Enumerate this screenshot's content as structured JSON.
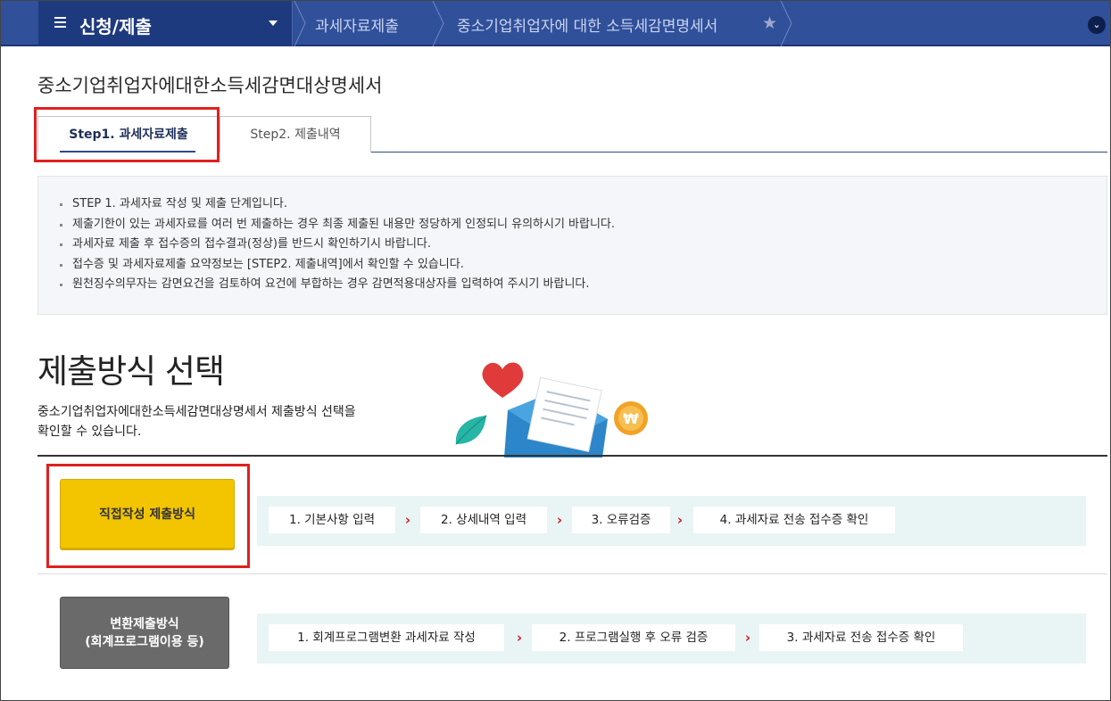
{
  "nav": {
    "menu_label": "신청/제출",
    "breadcrumb_1": "과세자료제출",
    "breadcrumb_2": "중소기업취업자에 대한 소득세감면명세서"
  },
  "page_title": "중소기업취업자에대한소득세감면대상명세서",
  "tabs": {
    "step1": "Step1. 과세자료제출",
    "step2": "Step2. 제출내역"
  },
  "info_items": [
    "STEP 1. 과세자료 작성 및 제출 단계입니다.",
    "제출기한이 있는 과세자료를 여러 번 제출하는 경우 최종 제출된 내용만 정당하게 인정되니 유의하시기 바랍니다.",
    "과세자료 제출 후 접수증의 접수결과(정상)를 반드시 확인하기시 바랍니다.",
    "접수증 및 과세자료제출 요약정보는 [STEP2. 제출내역]에서 확인할 수 있습니다.",
    "원천징수의무자는 감면요건을 검토하여 요건에 부합하는 경우 감면적용대상자를 입력하여 주시기 바랍니다."
  ],
  "section": {
    "heading": "제출방식 선택",
    "desc_line1": "중소기업취업자에대한소득세감면대상명세서 제출방식 선택을",
    "desc_line2": "확인할 수 있습니다."
  },
  "methods": {
    "direct": {
      "label": "직접작성 제출방식",
      "steps": [
        "1. 기본사항 입력",
        "2. 상세내역 입력",
        "3. 오류검증",
        "4. 과세자료 전송 접수증 확인"
      ]
    },
    "convert": {
      "label_line1": "변환제출방식",
      "label_line2": "(회계프로그램이용 등)",
      "steps": [
        "1. 회계프로그램변환 과세자료 작성",
        "2. 프로그램실행 후 오류 검증",
        "3. 과세자료 전송 접수증 확인"
      ]
    }
  },
  "colors": {
    "nav_bg": "#31509a",
    "accent_red": "#e02020",
    "direct_btn": "#f2c500",
    "convert_btn": "#6a6a6a",
    "steps_bg": "#e9f4f4"
  },
  "icons": {
    "menu": "hamburger-icon",
    "dropdown": "chevron-down-icon",
    "favorite": "star-icon",
    "toggle": "chevron-down-circle-icon",
    "step_separator": "chevron-right-icon"
  }
}
